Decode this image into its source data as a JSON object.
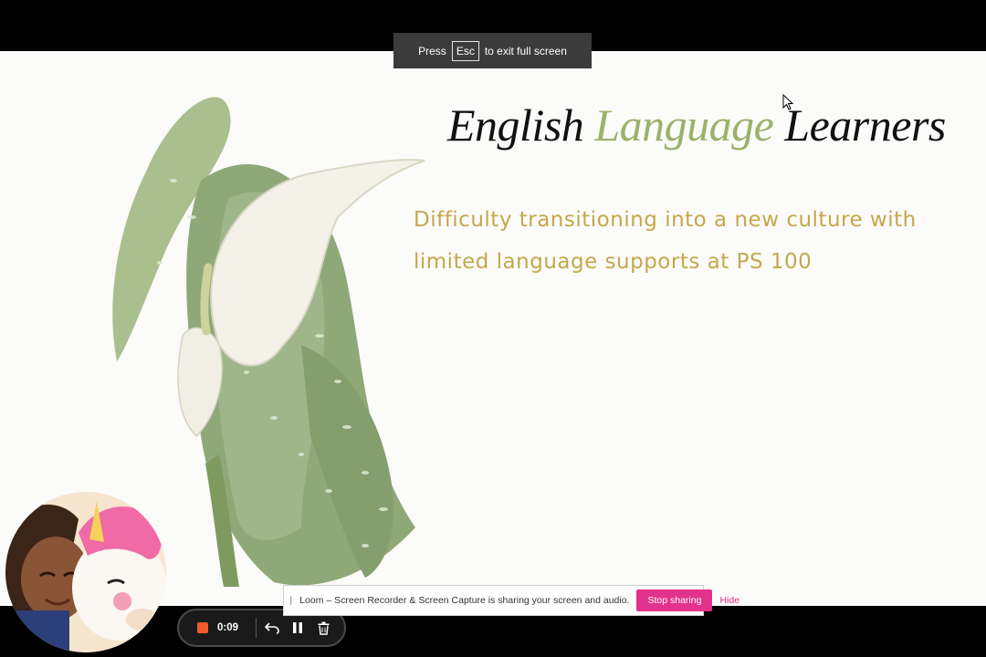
{
  "fullscreen_notice": {
    "before": "Press",
    "key": "Esc",
    "after": "to exit full screen"
  },
  "slide": {
    "title": {
      "part1": "English",
      "part2": "Language",
      "part3": "Learners"
    },
    "body_line1": "Difficulty transitioning into a new culture with",
    "body_line2": "limited language supports at PS 100"
  },
  "recorder": {
    "time": "0:09"
  },
  "share_bar": {
    "message": "Loom – Screen Recorder & Screen Capture is sharing your screen and audio.",
    "stop_label": "Stop sharing",
    "hide_label": "Hide"
  },
  "colors": {
    "accent_pink": "#e2328c",
    "title_green": "#9bb26a",
    "body_gold": "#c4a84a",
    "record_orange": "#f25a2b"
  },
  "icons": [
    "record-stop-icon",
    "undo-icon",
    "pause-icon",
    "trash-icon",
    "drag-handle-icon",
    "mouse-pointer-icon"
  ]
}
